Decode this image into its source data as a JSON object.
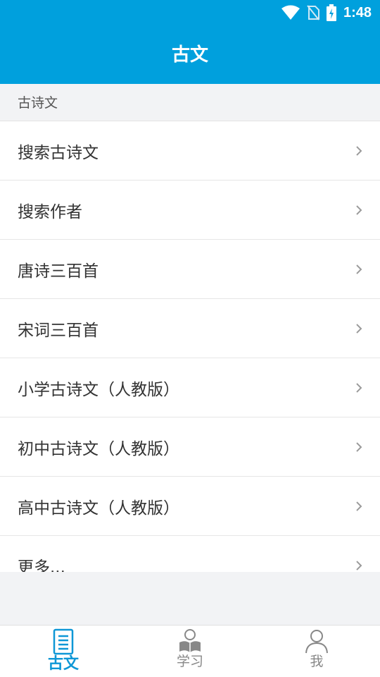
{
  "status_bar": {
    "time": "1:48",
    "icons": [
      "wifi-icon",
      "no-sim-icon",
      "battery-charging-icon"
    ]
  },
  "header": {
    "title": "古文"
  },
  "section": {
    "title": "古诗文"
  },
  "menu": {
    "items": [
      {
        "label": "搜索古诗文"
      },
      {
        "label": "搜索作者"
      },
      {
        "label": "唐诗三百首"
      },
      {
        "label": "宋词三百首"
      },
      {
        "label": "小学古诗文（人教版）"
      },
      {
        "label": "初中古诗文（人教版）"
      },
      {
        "label": "高中古诗文（人教版）"
      },
      {
        "label": "更多..."
      }
    ]
  },
  "tabbar": {
    "tabs": [
      {
        "label": "古文",
        "icon": "document-icon",
        "active": true
      },
      {
        "label": "学习",
        "icon": "study-icon",
        "active": false
      },
      {
        "label": "我",
        "icon": "profile-icon",
        "active": false
      }
    ]
  },
  "colors": {
    "primary": "#00a0dd",
    "active_tab": "#0e97d6",
    "inactive_tab": "#888888"
  }
}
